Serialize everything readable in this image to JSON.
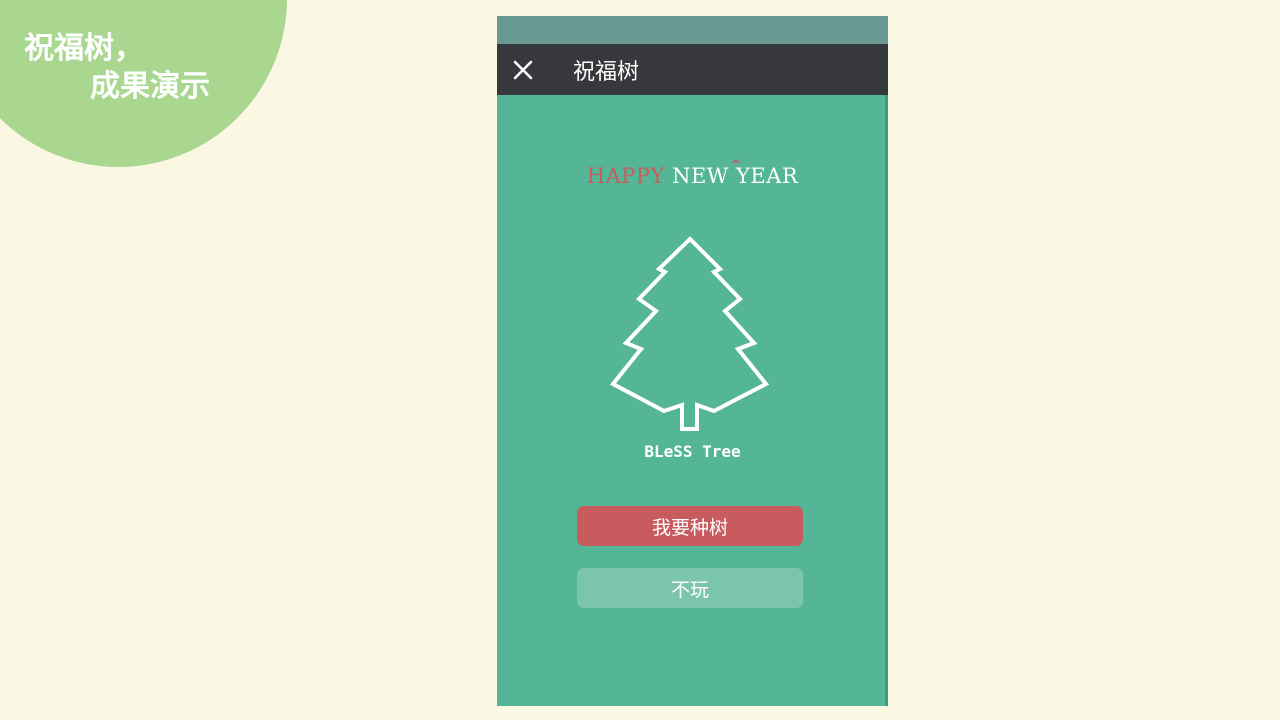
{
  "slide": {
    "title_line1": "祝福树，",
    "title_line2": "成果演示"
  },
  "nav": {
    "title": "祝福树",
    "close_icon": "close-icon"
  },
  "main": {
    "headline": [
      "HAPPY",
      " NEW ",
      "YEAR"
    ],
    "tree_label": "BLeSS Tree",
    "plant_button": "我要种树",
    "skip_button": "不玩"
  },
  "colors": {
    "background": "#faf8e3",
    "accent_circle": "#aad790",
    "phone_bg": "#55b697",
    "nav_bg": "#37383c",
    "primary_button": "#c75b5d",
    "secondary_button": "#7cc5ad"
  }
}
